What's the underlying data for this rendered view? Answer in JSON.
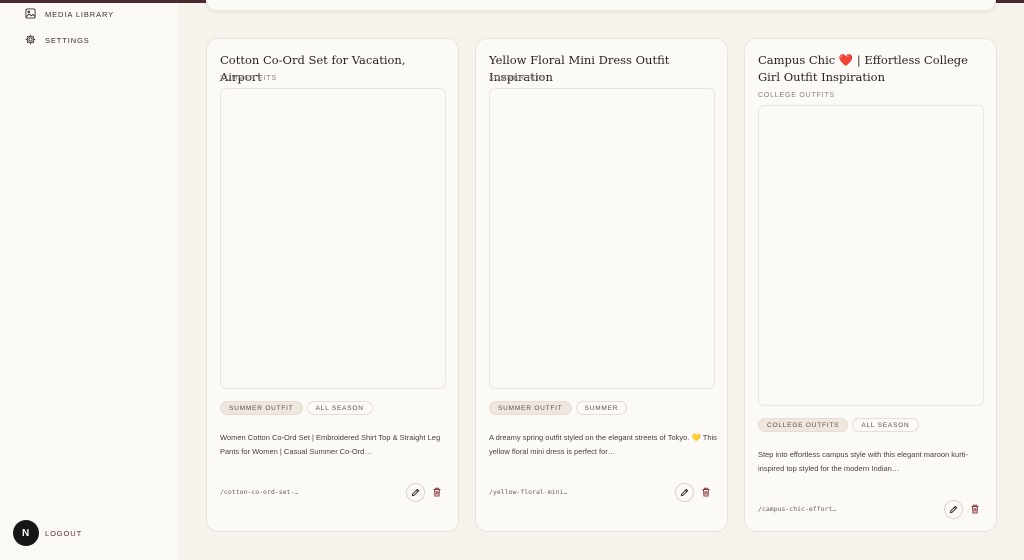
{
  "sidebar": {
    "items": [
      {
        "label": "MEDIA LIBRARY",
        "icon": "image-icon"
      },
      {
        "label": "SETTINGS",
        "icon": "gear-icon"
      }
    ],
    "logout_label": "LOGOUT",
    "badge_letter": "N"
  },
  "cards": [
    {
      "title": "Cotton Co-Ord Set for Vacation, Airport",
      "category": "SUMMER FITS",
      "tags": [
        "SUMMER OUTFIT",
        "ALL SEASON"
      ],
      "description": "Women Cotton Co-Ord Set | Embroidered Shirt Top & Straight Leg Pants for Women | Casual Summer Co-Ord…",
      "slug": "/cotton-co-ord-set-…"
    },
    {
      "title": "Yellow Floral Mini Dress Outfit Inspiration",
      "category": "SUMMER FITS",
      "tags": [
        "SUMMER OUTFIT",
        "SUMMER"
      ],
      "description": "A dreamy spring outfit styled on the elegant streets of Tokyo. 💛 This yellow floral mini dress is perfect for…",
      "slug": "/yellow-floral-mini…"
    },
    {
      "title": "Campus Chic ❤️ | Effortless College Girl Outfit Inspiration",
      "category": "COLLEGE OUTFITS",
      "tags": [
        "COLLEGE OUTFITS",
        "ALL SEASON"
      ],
      "description": "Step into effortless campus style with this elegant maroon kurti-inspired top styled for the modern Indian…",
      "slug": "/campus-chic-effort…"
    }
  ],
  "colors": {
    "accent": "#4a2a2f",
    "delete": "#8a3a3f",
    "background": "#f6f2ec",
    "card": "#fcfaf7"
  }
}
